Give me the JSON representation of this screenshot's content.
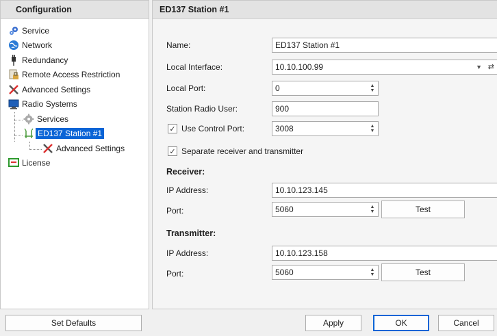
{
  "nav": {
    "header": "Configuration",
    "items": [
      {
        "label": "Service"
      },
      {
        "label": "Network"
      },
      {
        "label": "Redundancy"
      },
      {
        "label": "Remote Access Restriction"
      },
      {
        "label": "Advanced Settings"
      },
      {
        "label": "Radio Systems"
      },
      {
        "label": "Services"
      },
      {
        "label": "ED137 Station #1"
      },
      {
        "label": "Advanced Settings"
      },
      {
        "label": "License"
      }
    ]
  },
  "detail": {
    "header": "ED137 Station #1",
    "name_label": "Name:",
    "name_value": "ED137 Station #1",
    "local_interface_label": "Local Interface:",
    "local_interface_value": "10.10.100.99",
    "local_port_label": "Local Port:",
    "local_port_value": "0",
    "station_radio_user_label": "Station Radio User:",
    "station_radio_user_value": "900",
    "use_control_port_label": "Use Control Port:",
    "use_control_port_value": "3008",
    "separate_label": "Separate receiver and transmitter",
    "receiver": {
      "title": "Receiver:",
      "ip_label": "IP Address:",
      "ip_value": "10.10.123.145",
      "port_label": "Port:",
      "port_value": "5060",
      "test_label": "Test"
    },
    "transmitter": {
      "title": "Transmitter:",
      "ip_label": "IP Address:",
      "ip_value": "10.10.123.158",
      "port_label": "Port:",
      "port_value": "5060",
      "test_label": "Test"
    }
  },
  "footer": {
    "set_defaults": "Set Defaults",
    "apply": "Apply",
    "ok": "OK",
    "cancel": "Cancel"
  },
  "colors": {
    "selection": "#0a64d6",
    "header_bg": "#e3e3e3"
  }
}
